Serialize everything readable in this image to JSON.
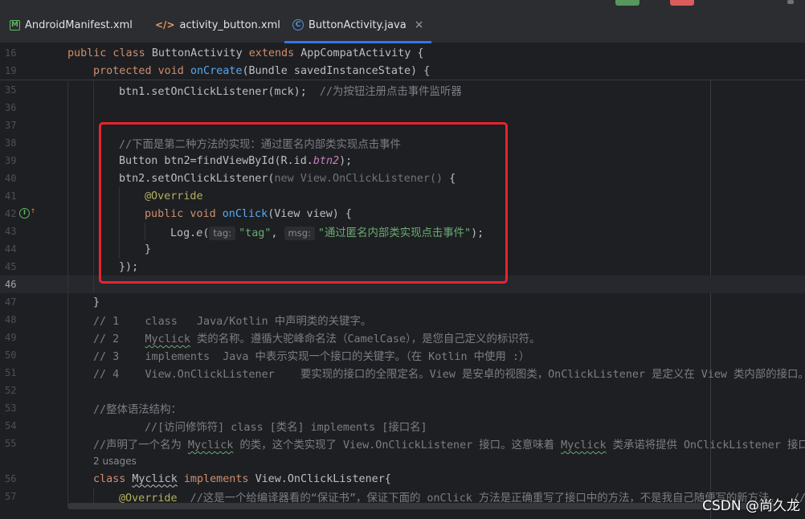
{
  "tabs": [
    {
      "label": "AndroidManifest.xml",
      "icon": "manifest-file-icon",
      "active": false
    },
    {
      "label": "activity_button.xml",
      "icon": "xml-file-icon",
      "active": false
    },
    {
      "label": "ButtonActivity.java",
      "icon": "java-class-icon",
      "active": true
    }
  ],
  "icons": {
    "manifest": "M",
    "xml": "</>",
    "class": "C",
    "close": "×",
    "override": "I",
    "arrow": "↑"
  },
  "line_numbers": [
    "16",
    "19",
    "35",
    "36",
    "37",
    "38",
    "39",
    "40",
    "41",
    "42",
    "43",
    "44",
    "45",
    "46",
    "47",
    "48",
    "49",
    "50",
    "51",
    "52",
    "53",
    "54",
    "55",
    "56",
    "57"
  ],
  "code": {
    "l16": {
      "kw1": "public class ",
      "cls": "ButtonActivity ",
      "kw2": "extends ",
      "rest": "AppCompatActivity {"
    },
    "l19": {
      "kw": "protected void ",
      "fn": "onCreate",
      "rest": "(Bundle savedInstanceState) {"
    },
    "l35": {
      "text": "btn1.setOnClickListener(mck);  ",
      "comment": "//为按钮注册点击事件监听器"
    },
    "l38": {
      "comment": "//下面是第二种方法的实现：通过匿名内部类实现点击事件"
    },
    "l39": {
      "pre": "Button btn2=findViewById(R.id.",
      "field": "btn2",
      "post": ");"
    },
    "l40": {
      "pre": "btn2.setOnClickListener(",
      "new": "new View.OnClickListener() ",
      "post": "{"
    },
    "l41": {
      "ann": "@Override"
    },
    "l42": {
      "kw": "public void ",
      "fn": "onClick",
      "rest": "(View view) {"
    },
    "l43": {
      "pre": "Log.",
      "method": "e",
      "open": "(",
      "hint1": "tag:",
      "str1": "\"tag\"",
      "comma": ", ",
      "hint2": "msg:",
      "str2": "\"通过匿名内部类实现点击事件\"",
      "post": ");"
    },
    "l44": {
      "text": "}"
    },
    "l45": {
      "text": "});"
    },
    "l47": {
      "text": "}"
    },
    "l48": {
      "c1": "// 1    class   Java/Kotlin 中声明类的关键字。"
    },
    "l49": {
      "c1": "// 2    ",
      "ul": "Myclick",
      "c2": " 类的名称。遵循大驼峰命名法（CamelCase），是您自己定义的标识符。"
    },
    "l50": {
      "c1": "// 3    implements  Java 中表示实现一个接口的关键字。（在 Kotlin 中使用 :）"
    },
    "l51": {
      "c1": "// 4    View.OnClickListener    要实现的接口的全限定名。View 是安卓的视图类，OnClickListener 是定义在 View 类内部的接口。"
    },
    "l53": {
      "c1": "//整体语法结构："
    },
    "l54": {
      "c1": "//[访问修饰符] class [类名] implements [接口名]"
    },
    "l55": {
      "c1": "//声明了一个名为 ",
      "ul1": "Myclick",
      "c2": " 的类，这个类实现了 View.OnClickListener 接口。这意味着 ",
      "ul2": "Myclick",
      "c3": " 类承诺将提供 OnClickListener 接口中"
    },
    "usages": "2 usages",
    "l56": {
      "kw": "class ",
      "cls": "Myclick",
      "kw2": " implements ",
      "rest": "View.OnClickListener{"
    },
    "l57": {
      "ann": "@Override",
      "comment": "  //这是一个给编译器看的“保证书”，保证下面的 onClick 方法是正确重写了接口中的方法，不是我自己随便写的新方法。  //编"
    }
  },
  "watermark": "CSDN @尚久龙"
}
